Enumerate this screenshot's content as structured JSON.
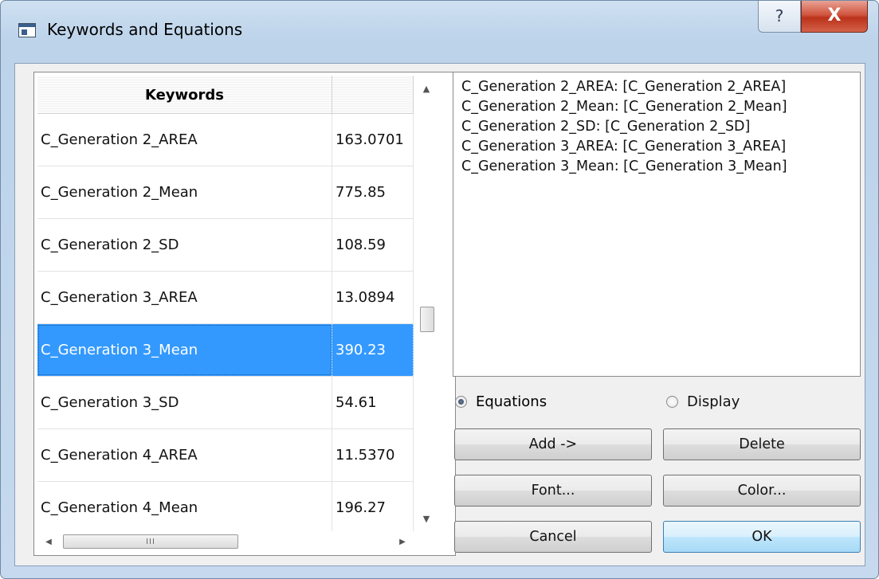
{
  "window": {
    "title": "Keywords and Equations",
    "help_glyph": "?",
    "close_glyph": "X"
  },
  "table": {
    "headers": [
      "Keywords",
      ""
    ],
    "rows": [
      {
        "keyword": "C_Generation 2_AREA",
        "value": "163.0701"
      },
      {
        "keyword": "C_Generation 2_Mean",
        "value": "775.85"
      },
      {
        "keyword": "C_Generation 2_SD",
        "value": "108.59"
      },
      {
        "keyword": "C_Generation 3_AREA",
        "value": "13.0894"
      },
      {
        "keyword": "C_Generation 3_Mean",
        "value": "390.23",
        "selected": true
      },
      {
        "keyword": "C_Generation 3_SD",
        "value": "54.61"
      },
      {
        "keyword": "C_Generation 4_AREA",
        "value": "11.5370"
      },
      {
        "keyword": "C_Generation 4_Mean",
        "value": "196.27"
      }
    ],
    "scroll_glyphs": {
      "up": "▲",
      "down": "▼",
      "left": "◀",
      "right": "▶",
      "grip": "III"
    }
  },
  "equations": [
    "C_Generation 2_AREA: [C_Generation 2_AREA]",
    "C_Generation 2_Mean: [C_Generation 2_Mean]",
    "C_Generation 2_SD: [C_Generation 2_SD]",
    "C_Generation 3_AREA: [C_Generation 3_AREA]",
    "C_Generation 3_Mean: [C_Generation 3_Mean]"
  ],
  "mode": {
    "options": [
      "Equations",
      "Display"
    ],
    "selected": "Equations"
  },
  "buttons": {
    "add": "Add ->",
    "delete": "Delete",
    "font": "Font...",
    "color": "Color...",
    "cancel": "Cancel",
    "ok": "OK"
  },
  "colors": {
    "selection": "#3399ff",
    "close_button": "#c9412a",
    "ok_button": "#bee6fd"
  }
}
